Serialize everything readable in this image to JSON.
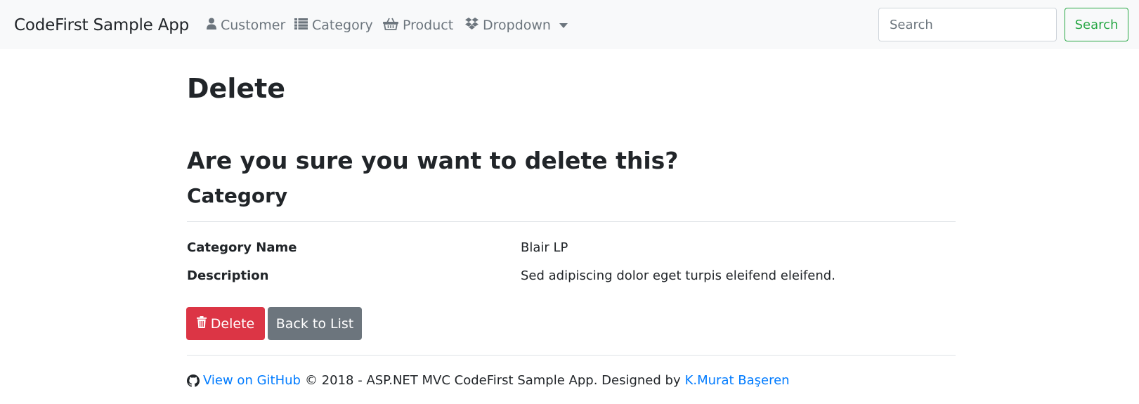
{
  "navbar": {
    "brand": "CodeFirst Sample App",
    "items": [
      {
        "label": "Customer",
        "icon": "user-icon"
      },
      {
        "label": "Category",
        "icon": "list-icon"
      },
      {
        "label": "Product",
        "icon": "shopping-basket-icon"
      },
      {
        "label": "Dropdown",
        "icon": "dropbox-icon"
      }
    ],
    "search": {
      "placeholder": "Search",
      "value": ""
    },
    "search_button": "Search"
  },
  "page": {
    "title": "Delete",
    "confirm_text": "Are you sure you want to delete this?",
    "entity_title": "Category",
    "fields": [
      {
        "label": "Category Name",
        "value": "Blair LP"
      },
      {
        "label": "Description",
        "value": "Sed adipiscing dolor eget turpis eleifend eleifend."
      }
    ],
    "actions": {
      "delete": "Delete",
      "back": "Back to List"
    }
  },
  "footer": {
    "github_link": "View on GitHub",
    "text": "© 2018 - ASP.NET MVC CodeFirst Sample App. Designed by",
    "author_link": "K.Murat Başeren"
  },
  "colors": {
    "navbar_bg": "#f8f9fa",
    "danger": "#dc3545",
    "secondary": "#6c757d",
    "success": "#28a745",
    "link": "#007bff"
  }
}
